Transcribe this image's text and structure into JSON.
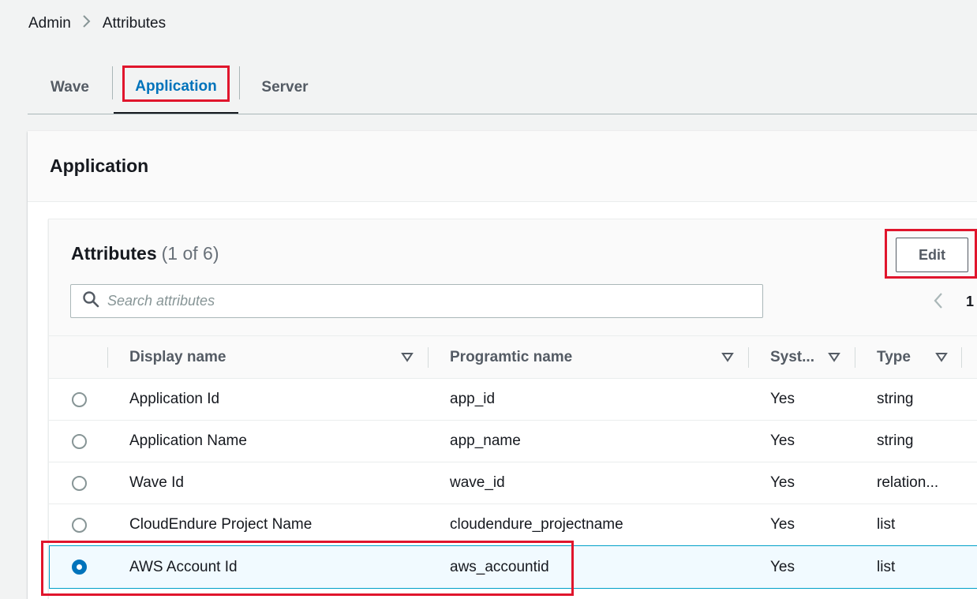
{
  "breadcrumb": {
    "items": [
      "Admin",
      "Attributes"
    ]
  },
  "tabs": [
    {
      "label": "Wave",
      "active": false
    },
    {
      "label": "Application",
      "active": true
    },
    {
      "label": "Server",
      "active": false
    }
  ],
  "container": {
    "title": "Application"
  },
  "panel": {
    "title": "Attributes",
    "count": "(1 of 6)",
    "edit_label": "Edit",
    "search": {
      "placeholder": "Search attributes",
      "value": ""
    },
    "pager": {
      "current_page": "1"
    }
  },
  "table": {
    "columns": [
      "Display name",
      "Programtic name",
      "Syst...",
      "Type"
    ],
    "rows": [
      {
        "display_name": "Application Id",
        "programmatic_name": "app_id",
        "system": "Yes",
        "type": "string",
        "selected": false
      },
      {
        "display_name": "Application Name",
        "programmatic_name": "app_name",
        "system": "Yes",
        "type": "string",
        "selected": false
      },
      {
        "display_name": "Wave Id",
        "programmatic_name": "wave_id",
        "system": "Yes",
        "type": "relation...",
        "selected": false
      },
      {
        "display_name": "CloudEndure Project Name",
        "programmatic_name": "cloudendure_projectname",
        "system": "Yes",
        "type": "list",
        "selected": false
      },
      {
        "display_name": "AWS Account Id",
        "programmatic_name": "aws_accountid",
        "system": "Yes",
        "type": "list",
        "selected": true
      }
    ]
  },
  "colors": {
    "accent": "#0073bb",
    "highlight": "#e0152c",
    "selected_row_bg": "#f1faff"
  }
}
